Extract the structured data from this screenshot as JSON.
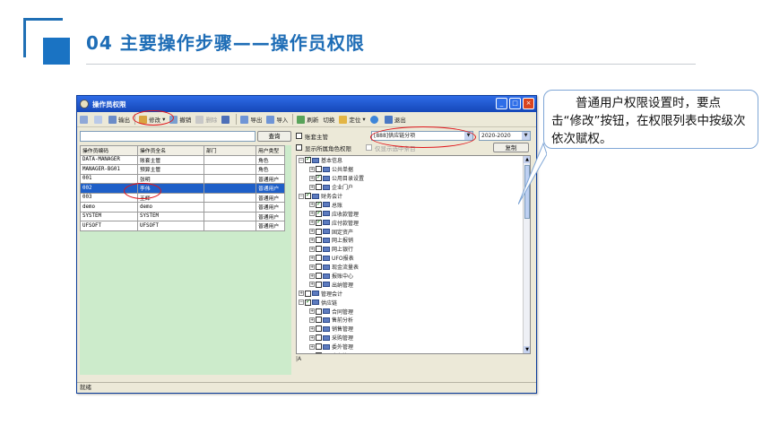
{
  "slide": {
    "title": "04  主要操作步骤——操作员权限"
  },
  "window": {
    "title": "操作员权限",
    "controls": [
      "_",
      "□",
      "×"
    ],
    "toolbar": [
      {
        "label": "",
        "icon": "print-icon",
        "disabled": false
      },
      {
        "label": "",
        "icon": "preview-icon",
        "disabled": false
      },
      {
        "label": "输出",
        "icon": "export-icon",
        "disabled": false
      },
      {
        "label": "修改",
        "icon": "edit-icon",
        "disabled": false,
        "dropdown": true
      },
      {
        "label": "撤销",
        "icon": "undo-icon",
        "disabled": false
      },
      {
        "label": "删除",
        "icon": "delete-icon",
        "disabled": true
      },
      {
        "label": "",
        "icon": "save-icon",
        "disabled": false
      },
      {
        "label": "导出",
        "icon": "export-out-icon",
        "disabled": false
      },
      {
        "label": "导入",
        "icon": "import-icon",
        "disabled": false
      },
      {
        "label": "刷新",
        "icon": "refresh-icon",
        "disabled": false
      },
      {
        "label": "切换",
        "icon": "switch-icon",
        "disabled": false
      },
      {
        "label": "定位",
        "icon": "locate-icon",
        "disabled": false,
        "dropdown": true
      },
      {
        "label": "",
        "icon": "help-icon",
        "disabled": false
      },
      {
        "label": "退出",
        "icon": "exit-icon",
        "disabled": false
      }
    ],
    "search": {
      "value": "",
      "button": "查询"
    },
    "table": {
      "headers": [
        "操作员编码",
        "操作员全名",
        "部门",
        "用户类型"
      ],
      "rows": [
        [
          "DATA-MANAGER",
          "账套主管",
          "",
          "角色"
        ],
        [
          "MANAGER-BG01",
          "预算主管",
          "",
          "角色"
        ],
        [
          "001",
          "张明",
          "",
          "普通用户"
        ],
        [
          "002",
          "李伟",
          "",
          "普通用户"
        ],
        [
          "003",
          "王辉",
          "",
          "普通用户"
        ],
        [
          "demo",
          "demo",
          "",
          "普通用户"
        ],
        [
          "SYSTEM",
          "SYSTEM",
          "",
          "普通用户"
        ],
        [
          "UFSOFT",
          "UFSOFT",
          "",
          "普通用户"
        ]
      ],
      "selected_index": 3
    },
    "right": {
      "account_manager_label": "账套主管",
      "account_combo": "[888]供应链分项",
      "year_combo": "2020-2020",
      "show_role_label": "显示所属角色权限",
      "show_only_label": "仅显示选中条目",
      "copy_button": "复制",
      "tree": [
        {
          "level": 0,
          "label": "基本信息",
          "checked": true,
          "exp": "⊟"
        },
        {
          "level": 1,
          "label": "公共单据",
          "checked": false,
          "exp": "⊞"
        },
        {
          "level": 1,
          "label": "公用目录设置",
          "checked": true,
          "exp": "⊞"
        },
        {
          "level": 1,
          "label": "企业门户",
          "checked": false,
          "exp": "⊞"
        },
        {
          "level": 0,
          "label": "财务会计",
          "checked": true,
          "exp": "⊟"
        },
        {
          "level": 1,
          "label": "总账",
          "checked": true,
          "exp": "⊞"
        },
        {
          "level": 1,
          "label": "应收款管理",
          "checked": true,
          "exp": "⊞"
        },
        {
          "level": 1,
          "label": "应付款管理",
          "checked": true,
          "exp": "⊞"
        },
        {
          "level": 1,
          "label": "固定资产",
          "checked": false,
          "exp": "⊞"
        },
        {
          "level": 1,
          "label": "网上报销",
          "checked": false,
          "exp": "⊞"
        },
        {
          "level": 1,
          "label": "网上银行",
          "checked": false,
          "exp": "⊞"
        },
        {
          "level": 1,
          "label": "UFO报表",
          "checked": false,
          "exp": "⊞"
        },
        {
          "level": 1,
          "label": "现金流量表",
          "checked": false,
          "exp": "⊞"
        },
        {
          "level": 1,
          "label": "报账中心",
          "checked": false,
          "exp": "⊞"
        },
        {
          "level": 1,
          "label": "出纳管理",
          "checked": false,
          "exp": "⊞"
        },
        {
          "level": 0,
          "label": "管理会计",
          "checked": false,
          "exp": "⊞"
        },
        {
          "level": 0,
          "label": "供应链",
          "checked": true,
          "exp": "⊟"
        },
        {
          "level": 1,
          "label": "合同管理",
          "checked": false,
          "exp": "⊞"
        },
        {
          "level": 1,
          "label": "售前分析",
          "checked": false,
          "exp": "⊞"
        },
        {
          "level": 1,
          "label": "销售管理",
          "checked": false,
          "exp": "⊞"
        },
        {
          "level": 1,
          "label": "采购管理",
          "checked": false,
          "exp": "⊞"
        },
        {
          "level": 1,
          "label": "委外管理",
          "checked": false,
          "exp": "⊞"
        },
        {
          "level": 1,
          "label": "库存管理",
          "checked": false,
          "exp": "⊞"
        }
      ],
      "tree_bottom_text": "|A"
    },
    "status": "就绪"
  },
  "callout": {
    "text": "普通用户权限设置时，要点击“修改”按钮，在权限列表中按级次依次赋权。"
  },
  "colors": {
    "accent": "#1e6db6",
    "highlight": "#e0161b",
    "selected_row": "#1e5fc8",
    "grid_background": "#ccebcb"
  }
}
